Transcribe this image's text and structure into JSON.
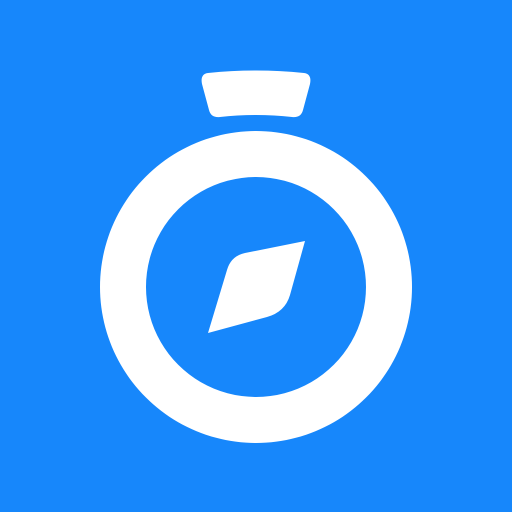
{
  "icon": {
    "name": "stopwatch-compass-icon",
    "background_color": "#1787FB",
    "foreground_color": "#FFFFFF"
  }
}
